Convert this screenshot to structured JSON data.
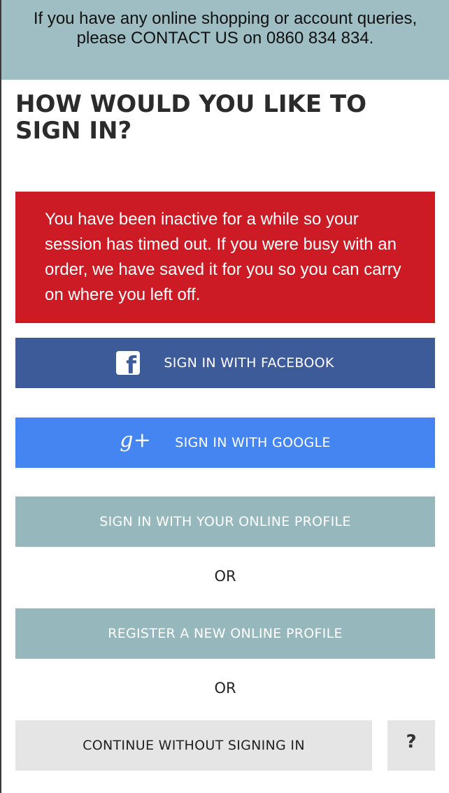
{
  "banner": {
    "text_before": "If you have any online shopping or account queries, please ",
    "contact_link": "CONTACT US",
    "text_after": " on 0860 834 834."
  },
  "page": {
    "title": "HOW WOULD YOU LIKE TO SIGN IN?"
  },
  "alert": {
    "message": "You have been inactive for a while so your session has timed out. If you were busy with an order, we have saved it for you so you can carry on where you left off.",
    "color": "#cc1b25"
  },
  "buttons": {
    "facebook": {
      "label": "SIGN IN WITH FACEBOOK",
      "icon": "facebook-icon",
      "color": "#3d5b99"
    },
    "google": {
      "label": "SIGN IN WITH GOOGLE",
      "icon": "google-plus-icon",
      "color": "#4485f1"
    },
    "profile": {
      "label": "SIGN IN WITH YOUR ONLINE PROFILE",
      "color": "#96b8bc"
    },
    "register": {
      "label": "REGISTER A NEW ONLINE PROFILE",
      "color": "#96b8bc"
    },
    "continue": {
      "label": "CONTINUE WITHOUT SIGNING IN"
    },
    "help": {
      "label": "?"
    }
  },
  "separators": {
    "or_1": "OR",
    "or_2": "OR"
  }
}
